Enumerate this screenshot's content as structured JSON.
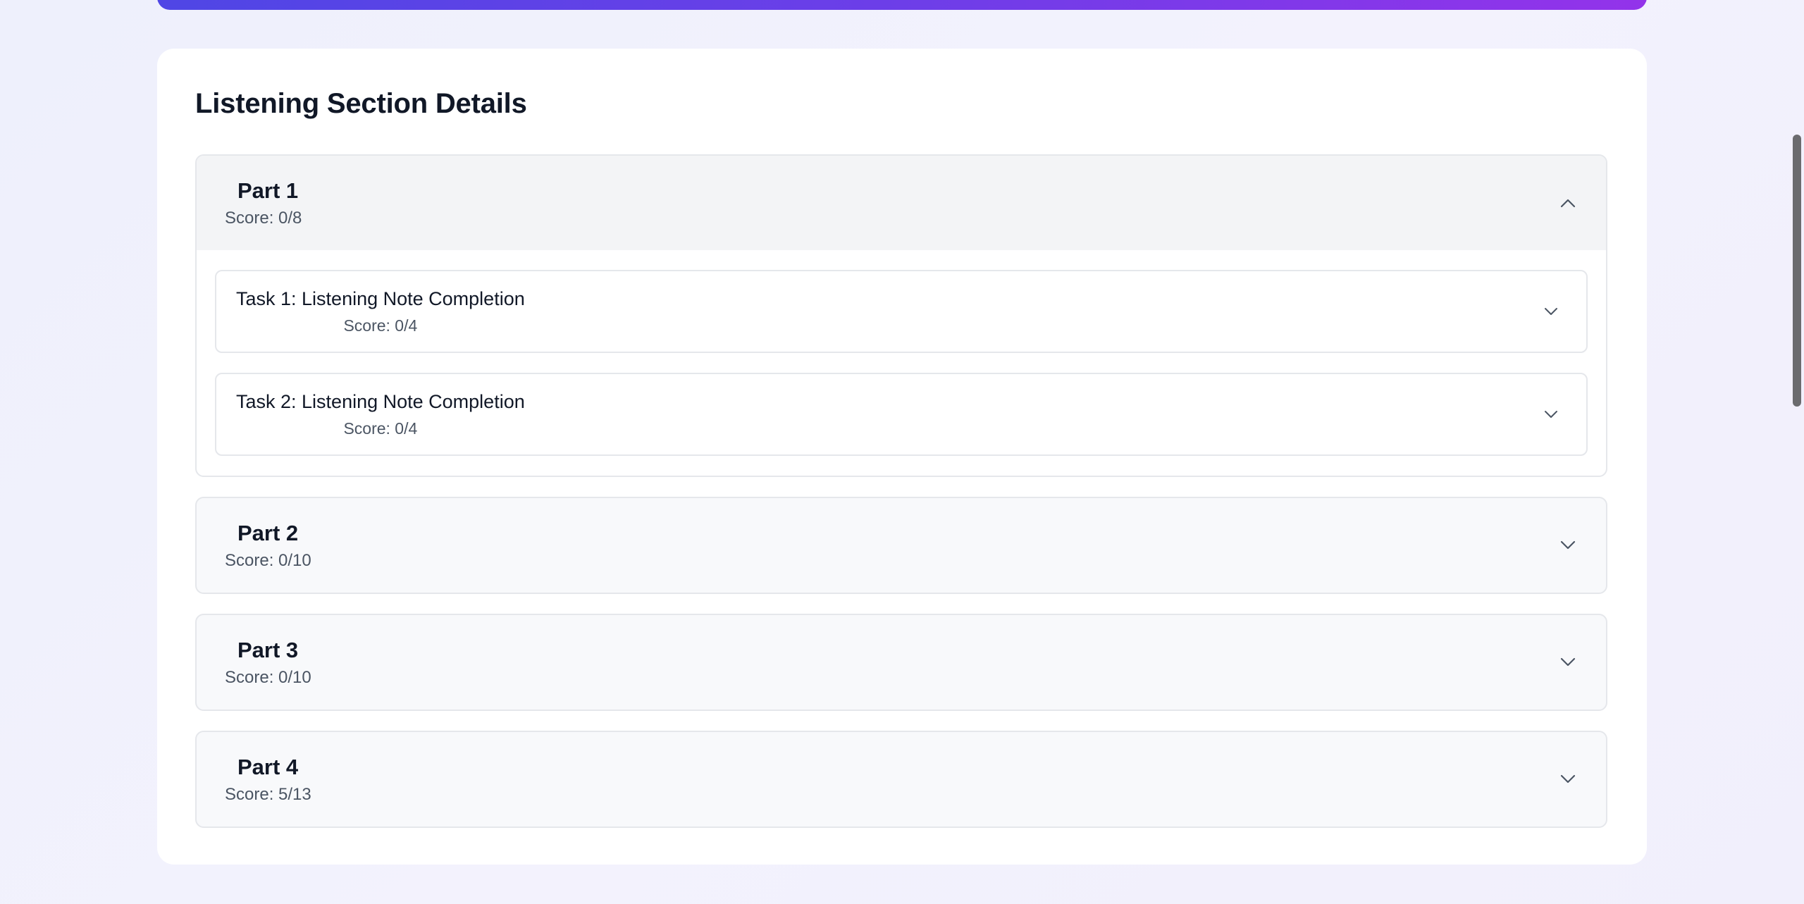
{
  "section": {
    "title": "Listening Section Details"
  },
  "parts": [
    {
      "title": "Part 1",
      "score": "Score: 0/8",
      "expanded": true,
      "tasks": [
        {
          "title": "Task 1: Listening Note Completion",
          "score": "Score: 0/4"
        },
        {
          "title": "Task 2: Listening Note Completion",
          "score": "Score: 0/4"
        }
      ]
    },
    {
      "title": "Part 2",
      "score": "Score: 0/10",
      "expanded": false
    },
    {
      "title": "Part 3",
      "score": "Score: 0/10",
      "expanded": false
    },
    {
      "title": "Part 4",
      "score": "Score: 5/13",
      "expanded": false
    }
  ],
  "icons": {
    "expanded": "chevron-up-icon",
    "collapsed": "chevron-down-icon"
  },
  "colors": {
    "banner_start": "#4f46e5",
    "banner_end": "#9333ea",
    "card_bg": "#ffffff",
    "page_bg": "#eef0fc"
  }
}
